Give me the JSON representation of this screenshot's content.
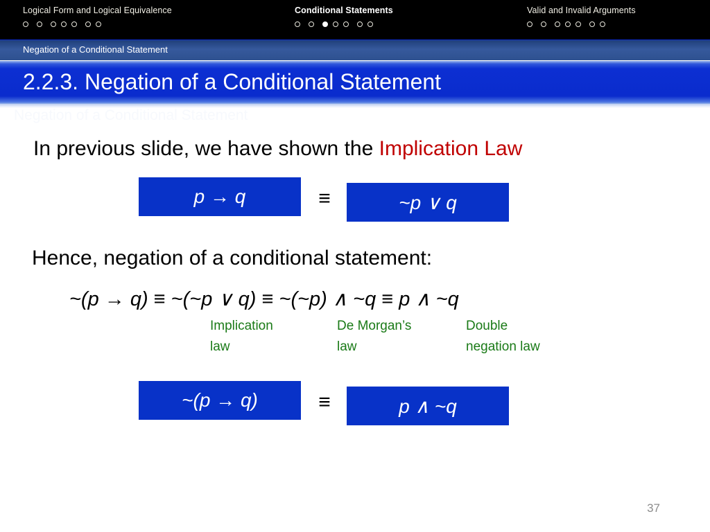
{
  "topnav": {
    "sections": [
      {
        "title": "Logical Form and Logical Equivalence",
        "dots": 7,
        "active_dot": -1
      },
      {
        "title": "Conditional Statements",
        "dots": 7,
        "active_dot": 2
      },
      {
        "title": "Valid and Invalid Arguments",
        "dots": 7,
        "active_dot": -1
      }
    ]
  },
  "breadcrumb": {
    "text": "Negation of a Conditional Statement"
  },
  "title": {
    "text": "2.2.3. Negation of a Conditional Statement",
    "ghost_text": "Negation of a Conditional Statement"
  },
  "content": {
    "intro": {
      "prefix": "In previous slide, we have shown the ",
      "accent": "Implication Law",
      "accent_color": "#c00000"
    },
    "top_row": {
      "left_box": "p → q",
      "equiv": "≡",
      "right_box": "~p ∨ q"
    },
    "hence": "Hence, negation of a conditional statement:",
    "chain": [
      {
        "expr": "~(p → q)"
      },
      {
        "op": "≡"
      },
      {
        "expr": "~(~p ∨ q)"
      },
      {
        "op": "≡"
      },
      {
        "expr": "~(~p) ∧ ~q"
      },
      {
        "op": "≡"
      },
      {
        "expr": "p ∧ ~q"
      }
    ],
    "chain_text": "~(p → q) ≡ ~(~p ∨ q) ≡ ~(~p) ∧ ~q ≡ p ∧ ~q",
    "law_notes": [
      "Implication law",
      "De Morgan’s law",
      "Double negation law"
    ],
    "law_notes_color": "#1a7a17",
    "bottom_row": {
      "left_box": "~(p → q)",
      "equiv": "≡",
      "right_box": "p ∧ ~q"
    }
  },
  "footer": {
    "page_number": "37"
  },
  "colors": {
    "topnav_bg": "#000000",
    "breadcrumb_bg": "#2e5190",
    "title_bg": "#0a2ccd",
    "box_blue": "#0832c8",
    "accent_red": "#c00000",
    "note_green": "#1a7a17",
    "page_number_gray": "#8c8c8c"
  }
}
